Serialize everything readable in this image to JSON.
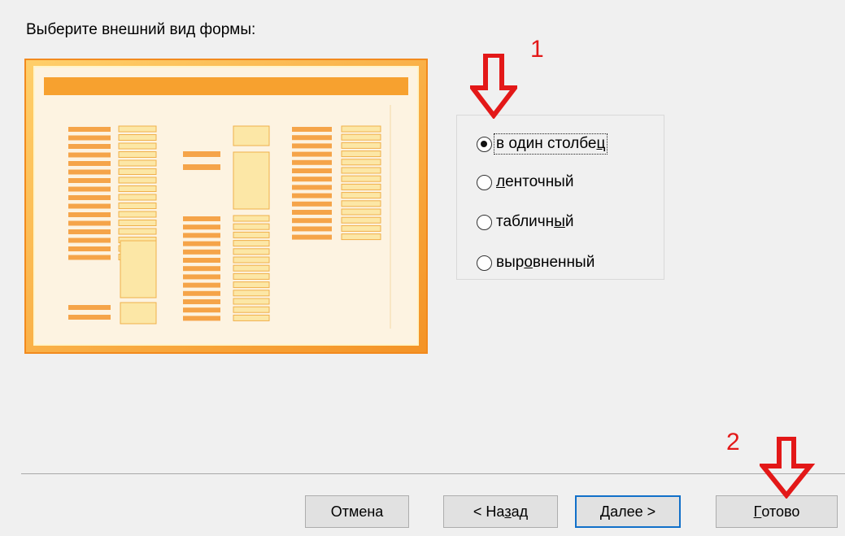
{
  "prompt": "Выберите внешний вид формы:",
  "layout_options": [
    {
      "label": "в один столбец",
      "selected": true,
      "focused": true
    },
    {
      "label": "ленточный",
      "selected": false,
      "focused": false
    },
    {
      "label": "табличный",
      "selected": false,
      "focused": false
    },
    {
      "label": "выровненный",
      "selected": false,
      "focused": false
    }
  ],
  "buttons": {
    "cancel": "Отмена",
    "back": "< Назад",
    "next": "Далее >",
    "finish": "Готово"
  },
  "annotations": {
    "marker_1": "1",
    "marker_2": "2"
  },
  "colors": {
    "accent_arrow": "#e31818",
    "preview_frame": "#fda94a",
    "preview_header": "#f7a12f",
    "default_button_border": "#1170c9"
  }
}
